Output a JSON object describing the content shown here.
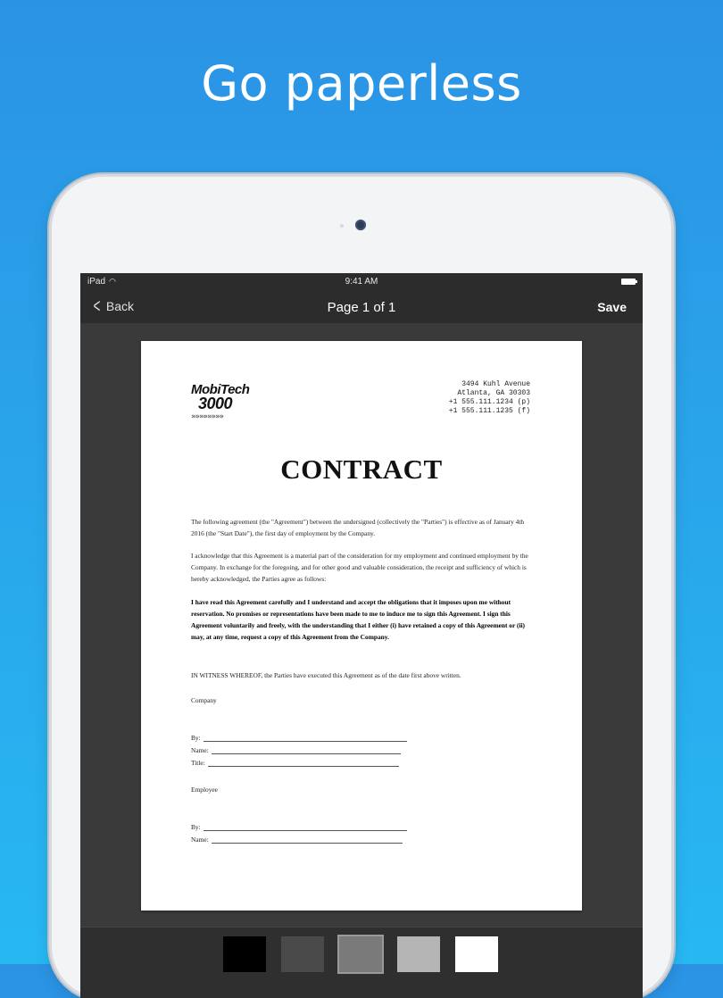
{
  "headline": "Go paperless",
  "status_bar": {
    "device": "iPad",
    "wifi_icon": "wifi-icon",
    "time": "9:41 AM",
    "battery_icon": "battery-icon"
  },
  "nav": {
    "back_label": "Back",
    "back_icon": "chevron-left-icon",
    "title": "Page 1 of 1",
    "save_label": "Save"
  },
  "document": {
    "logo": {
      "line1": "MobiTech",
      "line2": "3000",
      "arrows": "»»»»»»»»"
    },
    "address": [
      "3494 Kuhl Avenue",
      "Atlanta, GA 30303",
      "+1 555.111.1234 (p)",
      "+1 555.111.1235 (f)"
    ],
    "title": "CONTRACT",
    "paragraphs": [
      "The following agreement (the \"Agreement\") between the undersigned (collectively the \"Parties\") is effective as of January 4th 2016 (the \"Start Date\"), the first day of employment by the Company.",
      "I acknowledge that this Agreement is a material part of the consideration for my employment and continued employment by the Company. In exchange for the foregoing, and for other good and valuable consideration, the receipt and sufficiency of which is hereby acknowledged, the Parties agree as follows:",
      "I have read this Agreement carefully and I understand and accept the obligations that it imposes upon me without reservation. No promises or representations have been made to me to induce me to sign this Agreement. I sign this Agreement voluntarily and freely, with the understanding that I either (i) have retained a copy of this Agreement or (ii) may, at any time, request a copy of this Agreement from the Company.",
      "IN WITNESS WHEREOF, the Parties have executed this Agreement as of the date first above written."
    ],
    "company_label": "Company",
    "company_fields": [
      "By:",
      "Name:",
      "Title:"
    ],
    "employee_label": "Employee",
    "employee_fields": [
      "By:",
      "Name:"
    ]
  },
  "colors": {
    "background_top": "#2b93e4",
    "background_bottom": "#27b8f2",
    "swatches": [
      "#000000",
      "#4a4a4a",
      "#7a7a7a",
      "#b5b5b5",
      "#ffffff"
    ]
  }
}
